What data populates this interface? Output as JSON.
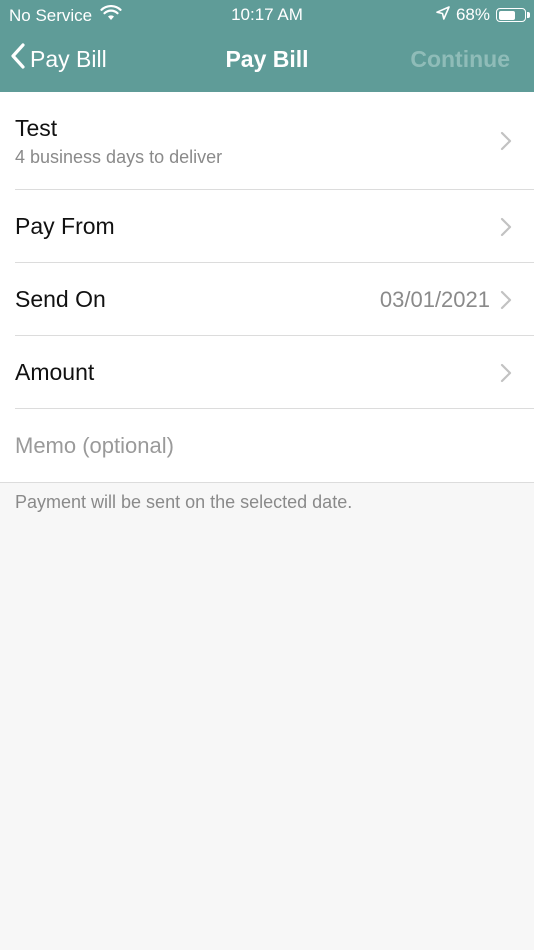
{
  "status_bar": {
    "carrier": "No Service",
    "time": "10:17 AM",
    "battery_percent": "68%",
    "battery_level": 0.68,
    "icons": [
      "wifi-icon",
      "location-icon",
      "battery-icon"
    ]
  },
  "nav": {
    "back_label": "Pay Bill",
    "title": "Pay Bill",
    "continue_label": "Continue"
  },
  "form": {
    "payee": {
      "title": "Test",
      "subtitle": "4 business days to deliver"
    },
    "pay_from": {
      "label": "Pay From"
    },
    "send_on": {
      "label": "Send On",
      "value": "03/01/2021"
    },
    "amount": {
      "label": "Amount"
    },
    "memo": {
      "placeholder": "Memo (optional)",
      "value": ""
    }
  },
  "footer": {
    "note": "Payment will be sent on the selected date."
  },
  "colors": {
    "header_bg": "#5f9c98",
    "disabled_action": "#8fbcb8",
    "secondary_text": "#8a8a8a",
    "page_bg": "#f7f7f7"
  }
}
